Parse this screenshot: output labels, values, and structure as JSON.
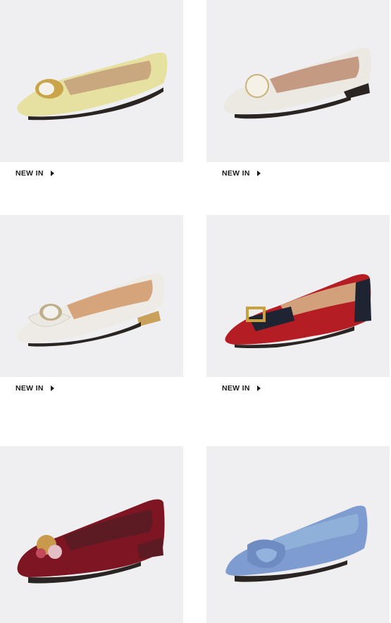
{
  "products": [
    {
      "label": "NEW IN",
      "color": "#e7e2a6",
      "accent": "#cfa84e",
      "description_icon": "yellow-flat-shoe"
    },
    {
      "label": "NEW IN",
      "color": "#ece9e3",
      "accent": "#d9c9a3",
      "description_icon": "white-flat-shoe"
    },
    {
      "label": "NEW IN",
      "color": "#eeebe6",
      "accent": "#c9a15a",
      "description_icon": "cream-bow-flat-shoe"
    },
    {
      "label": "NEW IN",
      "color": "#b51d24",
      "accent": "#c9a13d",
      "description_icon": "red-buckle-flat-shoe"
    },
    {
      "label": "",
      "color": "#7d1622",
      "accent": "#c99a4b",
      "description_icon": "burgundy-flat-shoe"
    },
    {
      "label": "",
      "color": "#7f9cd0",
      "accent": "#6f8cc2",
      "description_icon": "blue-flat-shoe"
    }
  ]
}
